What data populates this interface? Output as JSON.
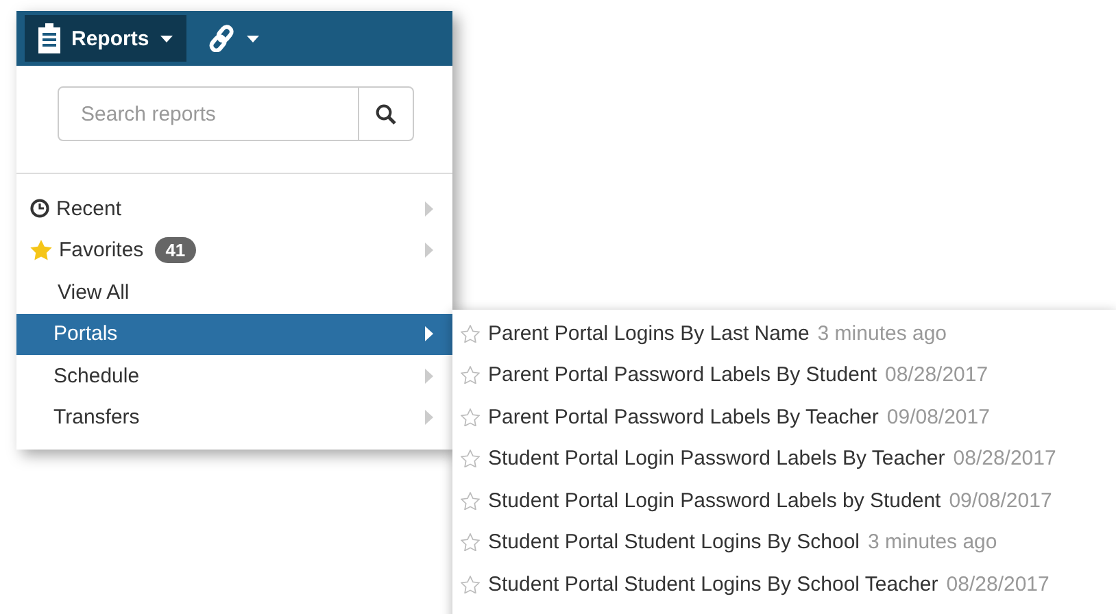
{
  "navbar": {
    "items": [
      {
        "kind": "reports",
        "label": "Reports",
        "selected": true
      },
      {
        "kind": "links",
        "selected": false
      }
    ]
  },
  "search": {
    "placeholder": "Search reports"
  },
  "menu": [
    {
      "kind": "recent",
      "label": "Recent",
      "has_submenu": true
    },
    {
      "kind": "favorites",
      "label": "Favorites",
      "badge": "41",
      "has_submenu": true
    },
    {
      "kind": "link",
      "label": "View All",
      "has_submenu": false
    }
  ],
  "categories": [
    {
      "label": "Portals",
      "selected": true
    },
    {
      "label": "Schedule",
      "selected": false
    },
    {
      "label": "Transfers",
      "selected": false
    }
  ],
  "submenu": [
    {
      "title": "Parent Portal Logins By Last Name",
      "time": "3 minutes ago",
      "favorite": false
    },
    {
      "title": "Parent Portal Password Labels By Student",
      "time": "08/28/2017",
      "favorite": false
    },
    {
      "title": "Parent Portal Password Labels By Teacher",
      "time": "09/08/2017",
      "favorite": false
    },
    {
      "title": "Student Portal Login Password Labels By Teacher",
      "time": "08/28/2017",
      "favorite": false
    },
    {
      "title": "Student Portal Login Password Labels by Student",
      "time": "09/08/2017",
      "favorite": false
    },
    {
      "title": "Student Portal Student Logins By School",
      "time": "3 minutes ago",
      "favorite": false
    },
    {
      "title": "Student Portal Student Logins By School Teacher",
      "time": "08/28/2017",
      "favorite": false
    }
  ]
}
